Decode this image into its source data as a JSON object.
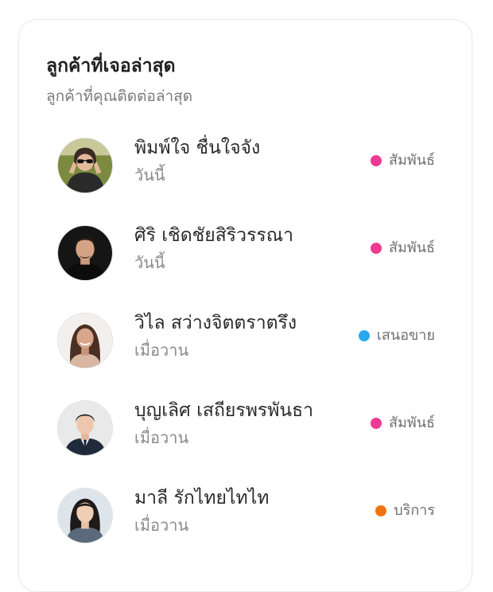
{
  "card": {
    "title": "ลูกค้าที่เจอล่าสุด",
    "subtitle": "ลูกค้าที่คุณติดต่อล่าสุด"
  },
  "customers": [
    {
      "name": "พิมพ์ใจ ชื่นใจจัง",
      "last_seen": "วันนี้",
      "status": "สัมพันธ์",
      "status_color": "#ee3a93",
      "avatar": "woman-sunglasses-outdoor"
    },
    {
      "name": "ศิริ เชิดชัยสิริวรรณา",
      "last_seen": "วันนี้",
      "status": "สัมพันธ์",
      "status_color": "#ee3a93",
      "avatar": "man-dark-background"
    },
    {
      "name": "วิไล สว่างจิตตราตรึง",
      "last_seen": "เมื่อวาน",
      "status": "เสนอขาย",
      "status_color": "#2aa8f0",
      "avatar": "woman-smiling"
    },
    {
      "name": "บุญเลิศ เสถียรพรพันธา",
      "last_seen": "เมื่อวาน",
      "status": "สัมพันธ์",
      "status_color": "#ee3a93",
      "avatar": "man-suit-tie"
    },
    {
      "name": "มาลี รักไทยไทไท",
      "last_seen": "เมื่อวาน",
      "status": "บริการ",
      "status_color": "#f07412",
      "avatar": "woman-blazer"
    }
  ]
}
